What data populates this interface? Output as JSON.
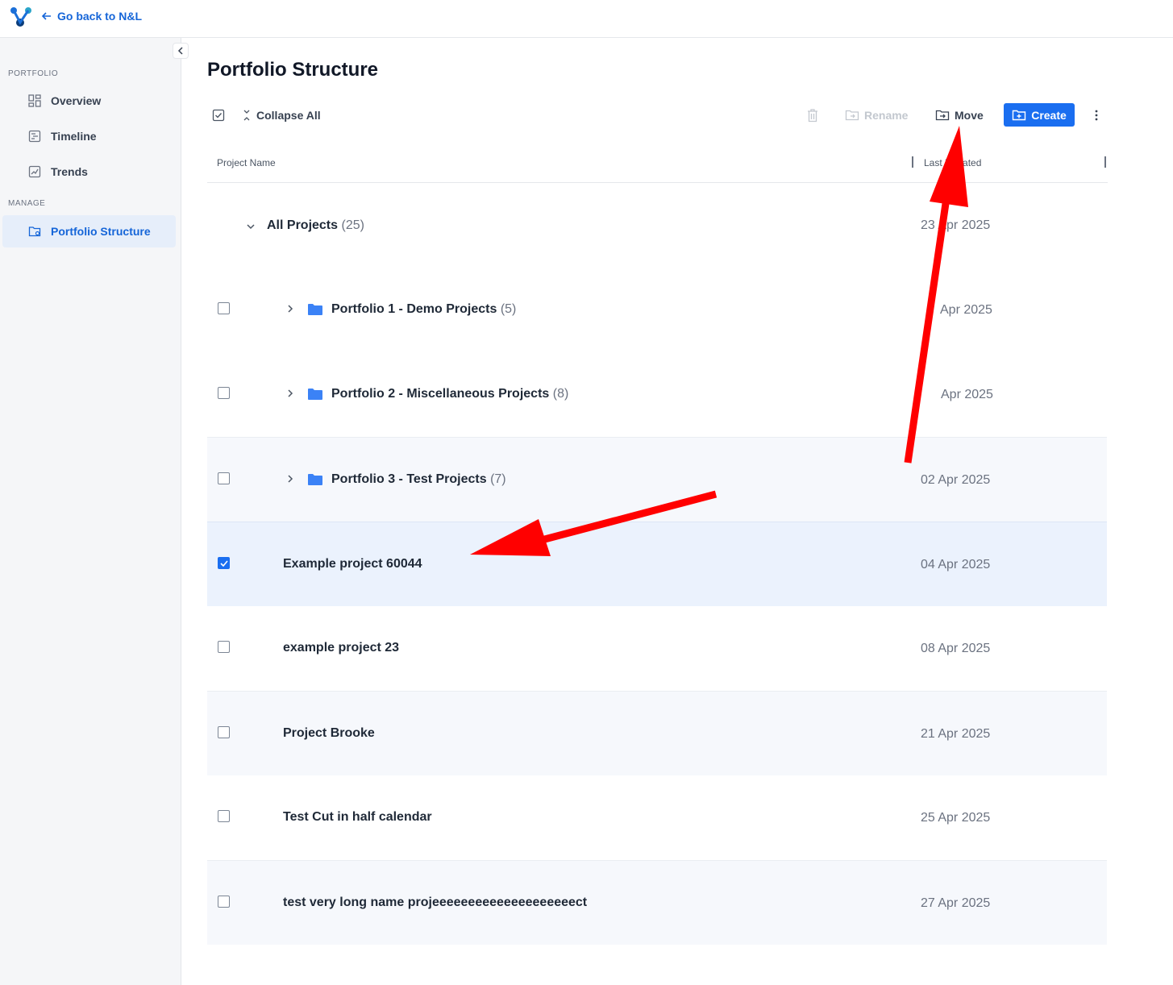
{
  "header": {
    "back_label": "Go back to N&L"
  },
  "sidebar": {
    "portfolio_section": "PORTFOLIO",
    "manage_section": "MANAGE",
    "items": [
      {
        "label": "Overview",
        "icon": "grid-icon"
      },
      {
        "label": "Timeline",
        "icon": "timeline-icon"
      },
      {
        "label": "Trends",
        "icon": "trend-chart-icon"
      },
      {
        "label": "Portfolio Structure",
        "icon": "folder-settings-icon",
        "active": true
      }
    ]
  },
  "main": {
    "title": "Portfolio Structure",
    "toolbar": {
      "collapse_all": "Collapse All",
      "rename": "Rename",
      "move": "Move",
      "create": "Create"
    },
    "columns": {
      "name": "Project Name",
      "last_updated": "Last Updated"
    },
    "root": {
      "label": "All Projects",
      "count": "(25)",
      "date": "23 Apr 2025"
    },
    "rows": [
      {
        "label": "Portfolio 1 - Demo Projects",
        "count": "(5)",
        "date": "Apr 2025",
        "type": "folder",
        "checked": false
      },
      {
        "label": "Portfolio 2 - Miscellaneous Projects",
        "count": "(8)",
        "date": "Apr 2025",
        "type": "folder",
        "checked": false
      },
      {
        "label": "Portfolio 3 - Test Projects",
        "count": "(7)",
        "date": "02 Apr 2025",
        "type": "folder",
        "checked": false
      },
      {
        "label": "Example project 60044",
        "date": "04 Apr 2025",
        "type": "project",
        "checked": true
      },
      {
        "label": "example project 23",
        "date": "08 Apr 2025",
        "type": "project",
        "checked": false
      },
      {
        "label": "Project Brooke",
        "date": "21 Apr 2025",
        "type": "project",
        "checked": false
      },
      {
        "label": "Test Cut in half calendar",
        "date": "25 Apr 2025",
        "type": "project",
        "checked": false
      },
      {
        "label": "test very long name projeeeeeeeeeeeeeeeeeeeect",
        "date": "27 Apr 2025",
        "type": "project",
        "checked": false
      }
    ]
  },
  "colors": {
    "accent": "#1a6ef0",
    "link": "#1565d8",
    "annotation_arrow": "#ff0000",
    "folder": "#3b82f6"
  }
}
